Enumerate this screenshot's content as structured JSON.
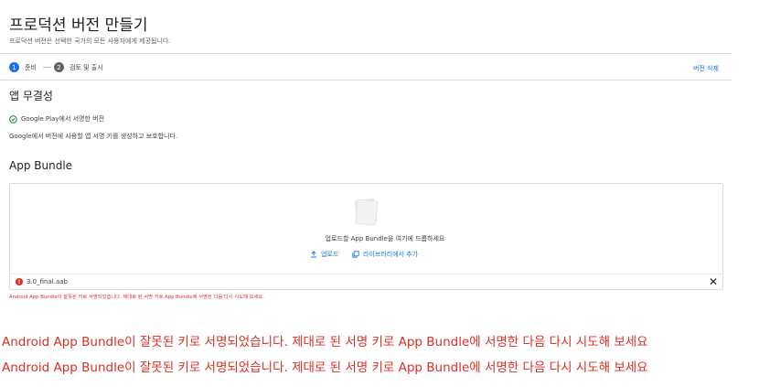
{
  "header": {
    "title": "프로덕션 버전 만들기",
    "subtitle": "프로덕션 버전은 선택한 국가의 모든 사용자에게 제공됩니다."
  },
  "steps": [
    {
      "number": "1",
      "label": "준비",
      "active": true
    },
    {
      "number": "2",
      "label": "검토 및 출시",
      "active": false
    }
  ],
  "actions": {
    "delete_release": "버전 삭제"
  },
  "app_integrity": {
    "heading": "앱 무결성",
    "status": "Google Play에서 서명한 버전",
    "description": "Google에서 버전에 사용할 앱 서명 키를 생성하고 보호합니다."
  },
  "app_bundle": {
    "heading": "App Bundle",
    "drop_text": "업로드할 App Bundle을 여기에 드롭하세요",
    "upload_button": "업로드",
    "library_button": "라이브러리에서 추가",
    "file": {
      "name": "3.0_final.aab",
      "status": "error"
    },
    "error_message": "Android App Bundle이 잘못된 키로 서명되었습니다. 제대로 된 서명 키로 App Bundle에 서명한 다음 다시 시도해 보세요."
  },
  "overlay_errors": [
    "Android App Bundle이 잘못된 키로 서명되었습니다. 제대로 된 서명 키로 App Bundle에 서명한 다음 다시 시도해 보세요",
    "Android App Bundle이 잘못된 키로 서명되었습니다. 제대로 된 서명 키로 App Bundle에 서명한 다음 다시 시도해 보세요"
  ],
  "colors": {
    "accent": "#1a73e8",
    "error": "#d93025",
    "success": "#1e8e3e",
    "divider": "#dadce0"
  }
}
